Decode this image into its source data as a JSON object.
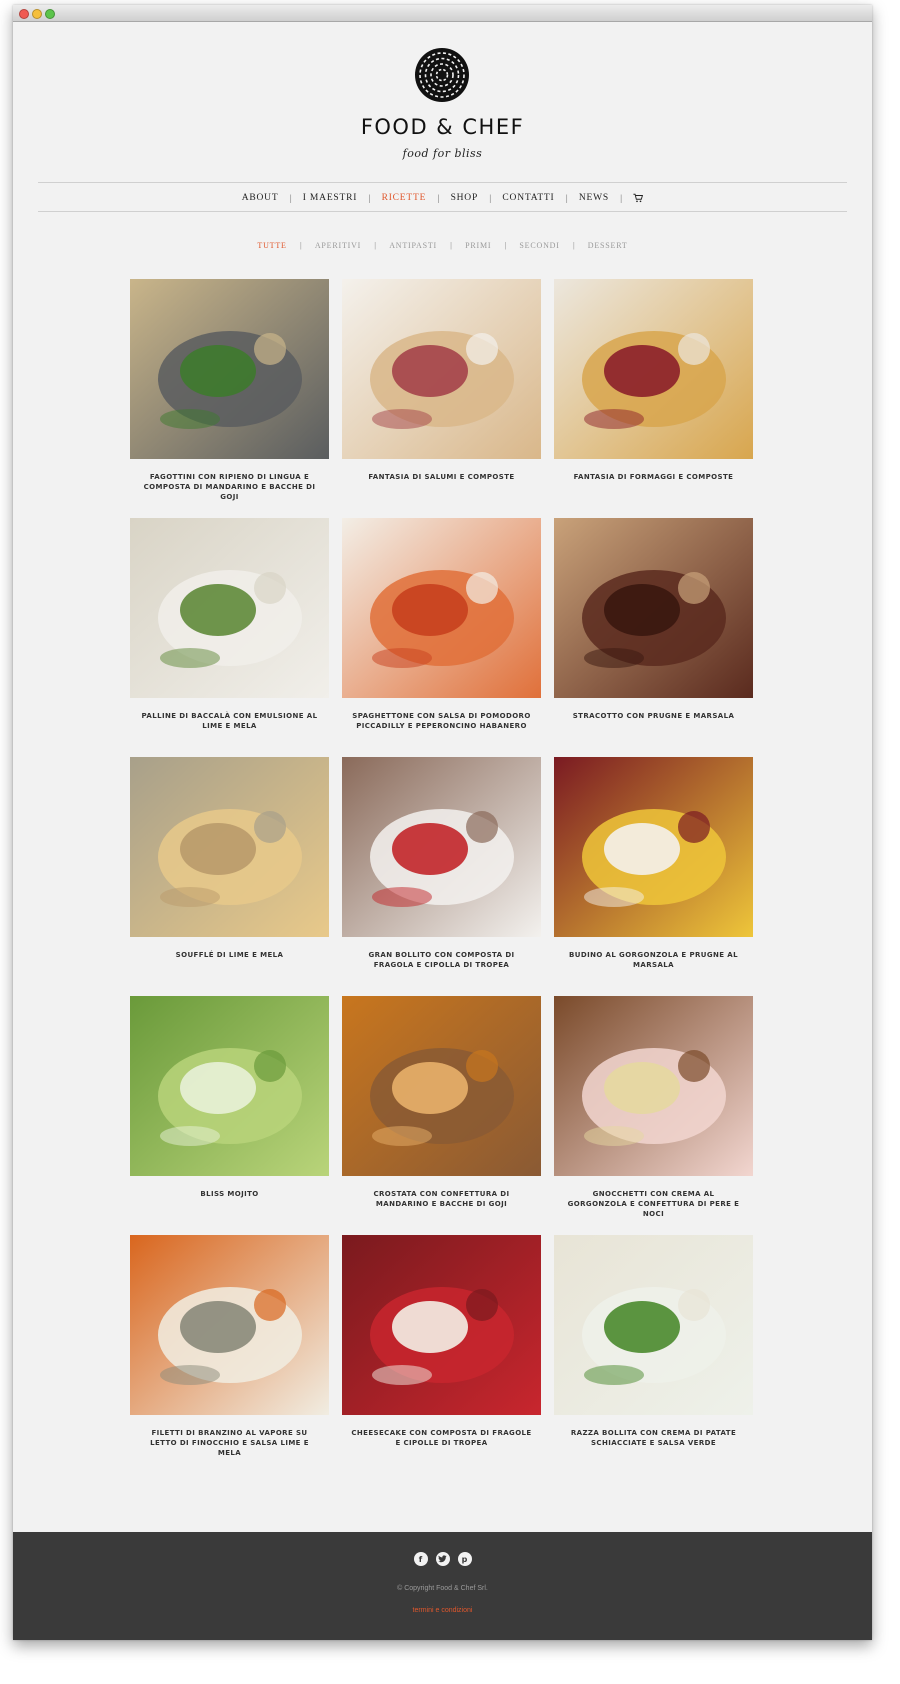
{
  "brand": {
    "title": "FOOD & CHEF",
    "tagline": "food for bliss"
  },
  "main_nav": {
    "items": [
      {
        "label": "ABOUT",
        "active": false
      },
      {
        "label": "I MAESTRI",
        "active": false
      },
      {
        "label": "RICETTE",
        "active": true
      },
      {
        "label": "SHOP",
        "active": false
      },
      {
        "label": "CONTATTI",
        "active": false
      },
      {
        "label": "NEWS",
        "active": false
      }
    ],
    "cart_icon": "shopping-cart-icon"
  },
  "category_filter": {
    "items": [
      {
        "label": "TUTTE",
        "active": true
      },
      {
        "label": "APERITIVI",
        "active": false
      },
      {
        "label": "ANTIPASTI",
        "active": false
      },
      {
        "label": "PRIMI",
        "active": false
      },
      {
        "label": "SECONDI",
        "active": false
      },
      {
        "label": "DESSERT",
        "active": false
      }
    ]
  },
  "recipes": [
    {
      "title": "FAGOTTINI CON RIPIENO DI LINGUA E COMPOSTA DI MANDARINO E BACCHE DI GOJI",
      "palette": [
        "#5a5d5f",
        "#3e7a2e",
        "#c9b58a"
      ]
    },
    {
      "title": "FANTASIA DI SALUMI E COMPOSTE",
      "palette": [
        "#d9b78a",
        "#a4434a",
        "#f4f1ec"
      ]
    },
    {
      "title": "FANTASIA DI FORMAGGI E COMPOSTE",
      "palette": [
        "#d8a64e",
        "#8b1f2a",
        "#ece7de"
      ]
    },
    {
      "title": "PALLINE DI BACCALÀ CON EMULSIONE AL LIME E MELA",
      "palette": [
        "#f1efea",
        "#5f8a3a",
        "#d9d4c6"
      ]
    },
    {
      "title": "SPAGHETTONE CON SALSA DI POMODORO PICCADILLY E PEPERONCINO HABANERO",
      "palette": [
        "#e0703a",
        "#c8401e",
        "#f3eee6"
      ]
    },
    {
      "title": "STRACOTTO CON PRUGNE E MARSALA",
      "palette": [
        "#5a2a1e",
        "#3a170f",
        "#c9a27a"
      ]
    },
    {
      "title": "SOUFFLÉ DI LIME E MELA",
      "palette": [
        "#e8c98a",
        "#b99a6a",
        "#a8a08a"
      ]
    },
    {
      "title": "GRAN BOLLITO CON COMPOSTA DI FRAGOLA E CIPOLLA DI TROPEA",
      "palette": [
        "#f3f1ee",
        "#c2262a",
        "#8a6a5a"
      ]
    },
    {
      "title": "BUDINO AL GORGONZOLA E PRUGNE AL MARSALA",
      "palette": [
        "#eec63a",
        "#f4f1ec",
        "#7a1a22"
      ]
    },
    {
      "title": "BLISS MOJITO",
      "palette": [
        "#b9d47a",
        "#e8f1d8",
        "#6a9a3a"
      ]
    },
    {
      "title": "CROSTATA CON CONFETTURA DI MANDARINO E BACCHE DI GOJI",
      "palette": [
        "#8a5a34",
        "#e8b06a",
        "#c8761e"
      ]
    },
    {
      "title": "GNOCCHETTI CON CREMA AL GORGONZOLA E CONFETTURA DI PERE E NOCI",
      "palette": [
        "#f2d6d0",
        "#e6d8a0",
        "#7a4a2a"
      ]
    },
    {
      "title": "FILETTI DI BRANZINO AL VAPORE SU LETTO DI FINOCCHIO E SALSA LIME E MELA",
      "palette": [
        "#f1ede2",
        "#8a8a7a",
        "#d9661e"
      ]
    },
    {
      "title": "CHEESECAKE CON COMPOSTA DI FRAGOLE E CIPOLLE DI TROPEA",
      "palette": [
        "#c8262e",
        "#f4f0e6",
        "#7a1a1e"
      ]
    },
    {
      "title": "RAZZA BOLLITA CON CREMA DI PATATE SCHIACCIATE E SALSA VERDE",
      "palette": [
        "#eef1ea",
        "#4a8a2e",
        "#e8e4d6"
      ]
    }
  ],
  "footer": {
    "social_icons": [
      "facebook-icon",
      "twitter-icon",
      "pinterest-icon"
    ],
    "copyright": "© Copyright Food & Chef Srl.",
    "terms_link": "termini e condizioni"
  },
  "colors": {
    "accent": "#e0572c",
    "page_bg": "#f2f2f2",
    "footer_bg": "#3a3a3a"
  }
}
